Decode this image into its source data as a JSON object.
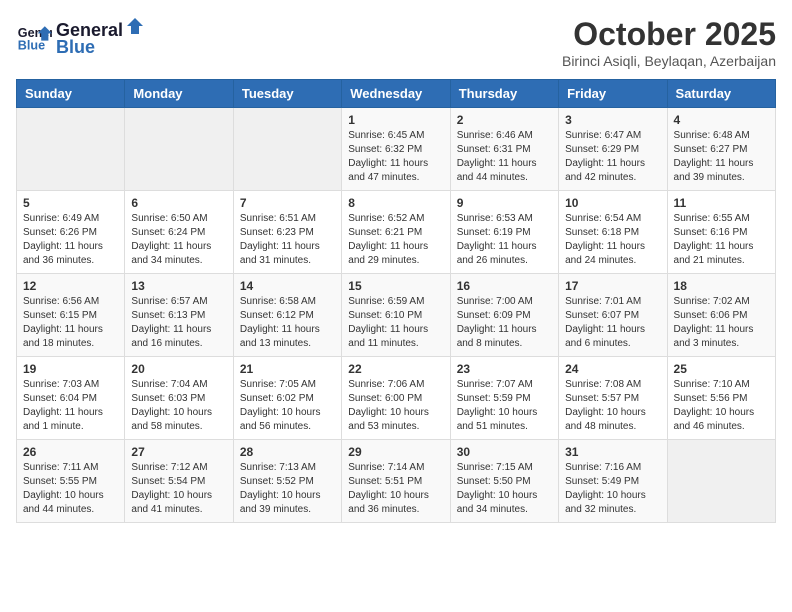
{
  "header": {
    "logo_line1": "General",
    "logo_line2": "Blue",
    "month_title": "October 2025",
    "subtitle": "Birinci Asiqli, Beylaqan, Azerbaijan"
  },
  "days_of_week": [
    "Sunday",
    "Monday",
    "Tuesday",
    "Wednesday",
    "Thursday",
    "Friday",
    "Saturday"
  ],
  "weeks": [
    [
      {
        "day": "",
        "info": ""
      },
      {
        "day": "",
        "info": ""
      },
      {
        "day": "",
        "info": ""
      },
      {
        "day": "1",
        "info": "Sunrise: 6:45 AM\nSunset: 6:32 PM\nDaylight: 11 hours and 47 minutes."
      },
      {
        "day": "2",
        "info": "Sunrise: 6:46 AM\nSunset: 6:31 PM\nDaylight: 11 hours and 44 minutes."
      },
      {
        "day": "3",
        "info": "Sunrise: 6:47 AM\nSunset: 6:29 PM\nDaylight: 11 hours and 42 minutes."
      },
      {
        "day": "4",
        "info": "Sunrise: 6:48 AM\nSunset: 6:27 PM\nDaylight: 11 hours and 39 minutes."
      }
    ],
    [
      {
        "day": "5",
        "info": "Sunrise: 6:49 AM\nSunset: 6:26 PM\nDaylight: 11 hours and 36 minutes."
      },
      {
        "day": "6",
        "info": "Sunrise: 6:50 AM\nSunset: 6:24 PM\nDaylight: 11 hours and 34 minutes."
      },
      {
        "day": "7",
        "info": "Sunrise: 6:51 AM\nSunset: 6:23 PM\nDaylight: 11 hours and 31 minutes."
      },
      {
        "day": "8",
        "info": "Sunrise: 6:52 AM\nSunset: 6:21 PM\nDaylight: 11 hours and 29 minutes."
      },
      {
        "day": "9",
        "info": "Sunrise: 6:53 AM\nSunset: 6:19 PM\nDaylight: 11 hours and 26 minutes."
      },
      {
        "day": "10",
        "info": "Sunrise: 6:54 AM\nSunset: 6:18 PM\nDaylight: 11 hours and 24 minutes."
      },
      {
        "day": "11",
        "info": "Sunrise: 6:55 AM\nSunset: 6:16 PM\nDaylight: 11 hours and 21 minutes."
      }
    ],
    [
      {
        "day": "12",
        "info": "Sunrise: 6:56 AM\nSunset: 6:15 PM\nDaylight: 11 hours and 18 minutes."
      },
      {
        "day": "13",
        "info": "Sunrise: 6:57 AM\nSunset: 6:13 PM\nDaylight: 11 hours and 16 minutes."
      },
      {
        "day": "14",
        "info": "Sunrise: 6:58 AM\nSunset: 6:12 PM\nDaylight: 11 hours and 13 minutes."
      },
      {
        "day": "15",
        "info": "Sunrise: 6:59 AM\nSunset: 6:10 PM\nDaylight: 11 hours and 11 minutes."
      },
      {
        "day": "16",
        "info": "Sunrise: 7:00 AM\nSunset: 6:09 PM\nDaylight: 11 hours and 8 minutes."
      },
      {
        "day": "17",
        "info": "Sunrise: 7:01 AM\nSunset: 6:07 PM\nDaylight: 11 hours and 6 minutes."
      },
      {
        "day": "18",
        "info": "Sunrise: 7:02 AM\nSunset: 6:06 PM\nDaylight: 11 hours and 3 minutes."
      }
    ],
    [
      {
        "day": "19",
        "info": "Sunrise: 7:03 AM\nSunset: 6:04 PM\nDaylight: 11 hours and 1 minute."
      },
      {
        "day": "20",
        "info": "Sunrise: 7:04 AM\nSunset: 6:03 PM\nDaylight: 10 hours and 58 minutes."
      },
      {
        "day": "21",
        "info": "Sunrise: 7:05 AM\nSunset: 6:02 PM\nDaylight: 10 hours and 56 minutes."
      },
      {
        "day": "22",
        "info": "Sunrise: 7:06 AM\nSunset: 6:00 PM\nDaylight: 10 hours and 53 minutes."
      },
      {
        "day": "23",
        "info": "Sunrise: 7:07 AM\nSunset: 5:59 PM\nDaylight: 10 hours and 51 minutes."
      },
      {
        "day": "24",
        "info": "Sunrise: 7:08 AM\nSunset: 5:57 PM\nDaylight: 10 hours and 48 minutes."
      },
      {
        "day": "25",
        "info": "Sunrise: 7:10 AM\nSunset: 5:56 PM\nDaylight: 10 hours and 46 minutes."
      }
    ],
    [
      {
        "day": "26",
        "info": "Sunrise: 7:11 AM\nSunset: 5:55 PM\nDaylight: 10 hours and 44 minutes."
      },
      {
        "day": "27",
        "info": "Sunrise: 7:12 AM\nSunset: 5:54 PM\nDaylight: 10 hours and 41 minutes."
      },
      {
        "day": "28",
        "info": "Sunrise: 7:13 AM\nSunset: 5:52 PM\nDaylight: 10 hours and 39 minutes."
      },
      {
        "day": "29",
        "info": "Sunrise: 7:14 AM\nSunset: 5:51 PM\nDaylight: 10 hours and 36 minutes."
      },
      {
        "day": "30",
        "info": "Sunrise: 7:15 AM\nSunset: 5:50 PM\nDaylight: 10 hours and 34 minutes."
      },
      {
        "day": "31",
        "info": "Sunrise: 7:16 AM\nSunset: 5:49 PM\nDaylight: 10 hours and 32 minutes."
      },
      {
        "day": "",
        "info": ""
      }
    ]
  ]
}
